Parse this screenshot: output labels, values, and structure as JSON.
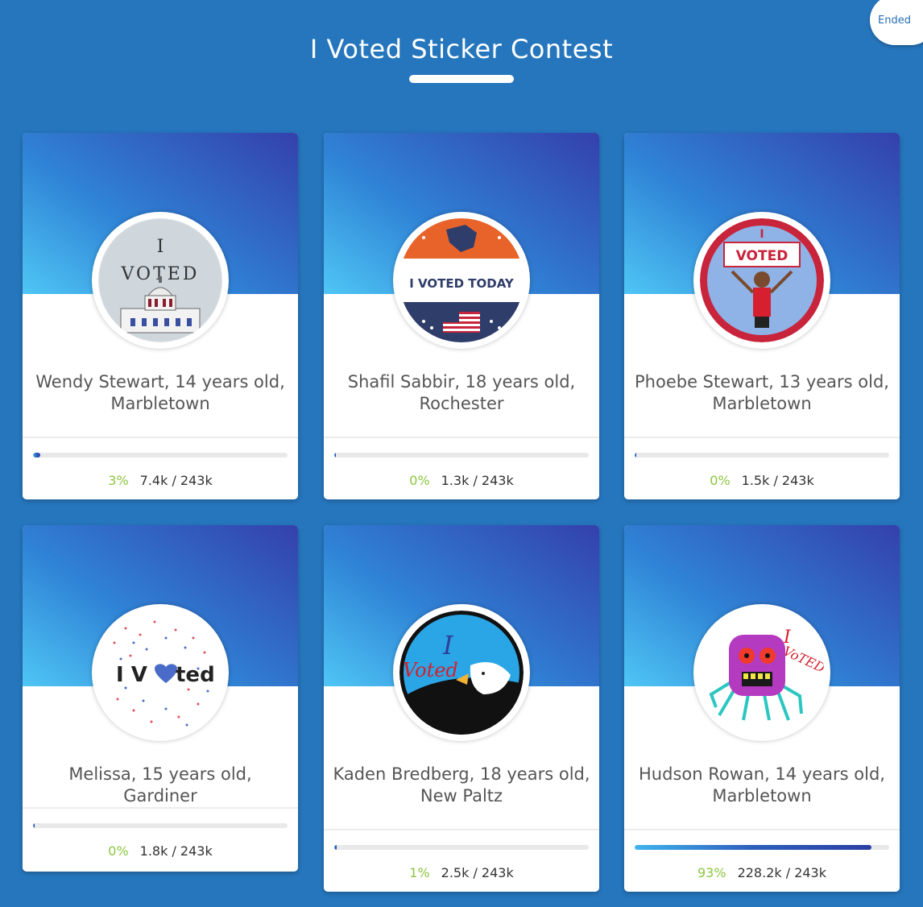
{
  "header": {
    "title": "I Voted Sticker Contest",
    "status_badge": "Ended"
  },
  "entries": [
    {
      "name": "Wendy Stewart, 14 years old, Marbletown",
      "percent_label": "3%",
      "votes_label": "7.4k / 243k",
      "progress": 0.03,
      "sticker_text": [
        "I",
        "VOTED"
      ]
    },
    {
      "name": "Shafil Sabbir, 18 years old, Rochester",
      "percent_label": "0%",
      "votes_label": "1.3k / 243k",
      "progress": 0.005,
      "sticker_text": [
        "I VOTED TODAY"
      ]
    },
    {
      "name": "Phoebe Stewart, 13 years old, Marbletown",
      "percent_label": "0%",
      "votes_label": "1.5k / 243k",
      "progress": 0.006,
      "sticker_text": [
        "I",
        "VOTED"
      ]
    },
    {
      "name": "Melissa, 15 years old, Gardiner",
      "percent_label": "0%",
      "votes_label": "1.8k / 243k",
      "progress": 0.007,
      "sticker_text": [
        "I V",
        "ted"
      ]
    },
    {
      "name": "Kaden Bredberg, 18 years old, New Paltz",
      "percent_label": "1%",
      "votes_label": "2.5k / 243k",
      "progress": 0.01,
      "sticker_text": [
        "I",
        "Voted"
      ]
    },
    {
      "name": "Hudson Rowan, 14 years old, Marbletown",
      "percent_label": "93%",
      "votes_label": "228.2k / 243k",
      "progress": 0.93,
      "sticker_text": [
        "I",
        "VoTED"
      ]
    }
  ],
  "colors": {
    "background": "#2676bd",
    "percent": "#8cc63f",
    "gradient_start": "#4fc6f5",
    "gradient_end": "#3440ad"
  }
}
